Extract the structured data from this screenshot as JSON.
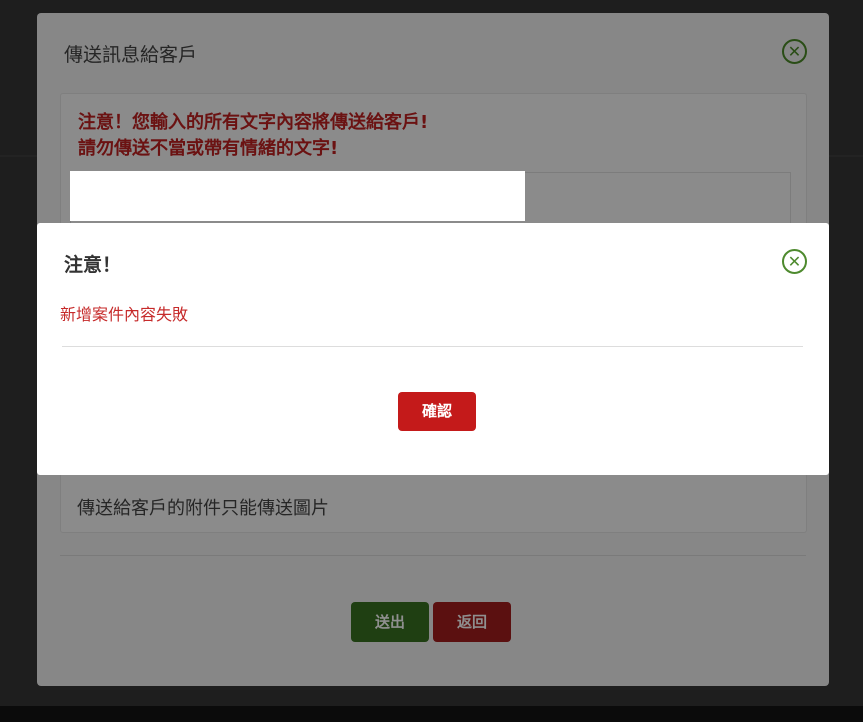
{
  "compose_modal": {
    "title": "傳送訊息給客戶",
    "close_icon": "close-circle-icon",
    "warning_line1": "注意！您輸入的所有文字內容將傳送給客戶!",
    "warning_line2": "請勿傳送不當或帶有情緒的文字!",
    "attachment_note": "傳送給客戶的附件只能傳送圖片",
    "send_label": "送出",
    "return_label": "返回"
  },
  "alert_dialog": {
    "title": "注意！",
    "close_icon": "close-circle-icon",
    "message": "新增案件內容失敗",
    "confirm_label": "確認"
  },
  "colors": {
    "confirm_button": "#c41a1a",
    "error_text": "#c62a2a",
    "close_icon": "#4e8a2e"
  }
}
